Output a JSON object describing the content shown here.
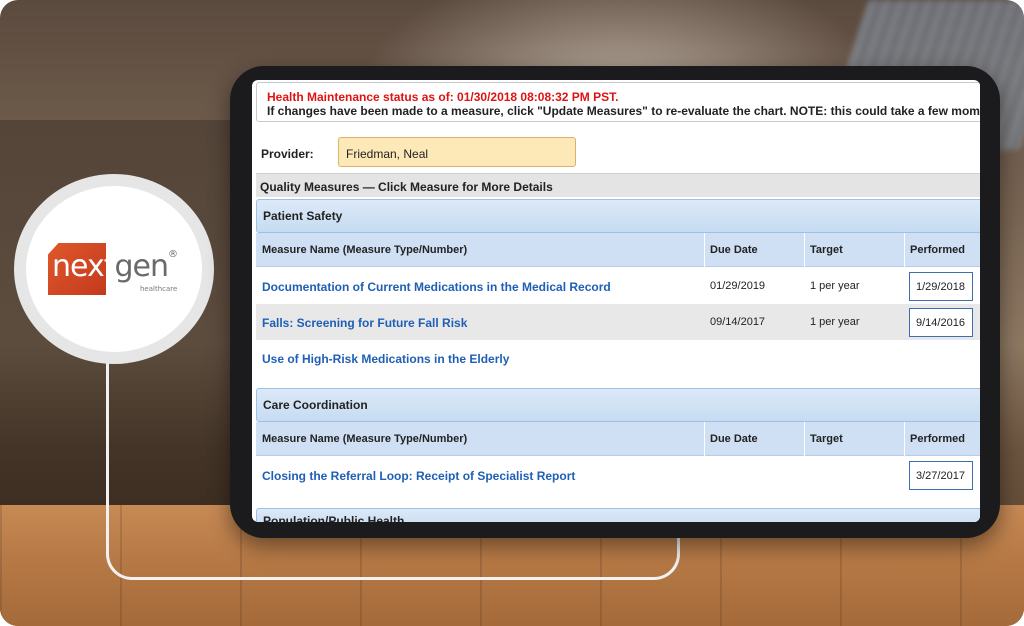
{
  "status": {
    "line": "Health Maintenance status as of:  01/30/2018 08:08:32 PM PST.",
    "note": "If changes have been made to a measure, click \"Update Measures\" to re-evaluate the chart. NOTE: this could take a few moments t"
  },
  "provider": {
    "label": "Provider:",
    "value": "Friedman, Neal"
  },
  "quality_header": "Quality Measures — Click Measure for More Details",
  "columns": {
    "name": "Measure Name (Measure Type/Number)",
    "due": "Due Date",
    "target": "Target",
    "performed": "Performed"
  },
  "sections": [
    {
      "title": "Patient Safety",
      "rows": [
        {
          "name": "Documentation of Current Medications in the Medical Record",
          "due": "01/29/2019",
          "target": "1 per year",
          "performed": "1/29/2018"
        },
        {
          "name": "Falls: Screening for Future Fall Risk",
          "due": "09/14/2017",
          "target": "1 per year",
          "performed": "9/14/2016"
        },
        {
          "name": "Use of High-Risk Medications in the Elderly",
          "due": "",
          "target": "",
          "performed": ""
        }
      ]
    },
    {
      "title": "Care Coordination",
      "rows": [
        {
          "name": "Closing the Referral Loop: Receipt of Specialist Report",
          "due": "",
          "target": "",
          "performed": "3/27/2017"
        }
      ]
    },
    {
      "title": "Population/Public Health",
      "rows": []
    }
  ],
  "logo": {
    "part1": "next",
    "part2": "gen",
    "mark": "®",
    "sub": "healthcare"
  },
  "colors": {
    "link": "#1f5fb5",
    "status_red": "#e01212",
    "brand_orange": "#d4481f",
    "section_blue": "#c6dcf2"
  }
}
